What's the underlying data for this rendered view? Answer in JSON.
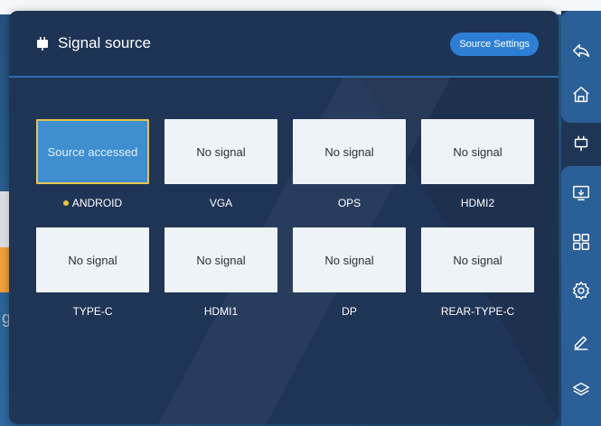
{
  "dialog": {
    "title": "Signal source",
    "settings_button": "Source Settings"
  },
  "sources": [
    {
      "status": "Source accessed",
      "name": "ANDROID",
      "active": true
    },
    {
      "status": "No signal",
      "name": "VGA",
      "active": false
    },
    {
      "status": "No signal",
      "name": "OPS",
      "active": false
    },
    {
      "status": "No signal",
      "name": "HDMI2",
      "active": false
    },
    {
      "status": "No signal",
      "name": "TYPE-C",
      "active": false
    },
    {
      "status": "No signal",
      "name": "HDMI1",
      "active": false
    },
    {
      "status": "No signal",
      "name": "DP",
      "active": false
    },
    {
      "status": "No signal",
      "name": "REAR-TYPE-C",
      "active": false
    }
  ],
  "background": {
    "text_fragment": "ger"
  },
  "rail": {
    "items": [
      "back-icon",
      "home-icon",
      "signal-source-icon",
      "screen-share-icon",
      "apps-icon",
      "settings-icon",
      "pen-icon",
      "layers-icon"
    ]
  },
  "colors": {
    "accent": "#2c7fd4",
    "active_tile": "#3e8ed0",
    "active_border": "#e6c451",
    "indicator_dot": "#f0c636"
  }
}
